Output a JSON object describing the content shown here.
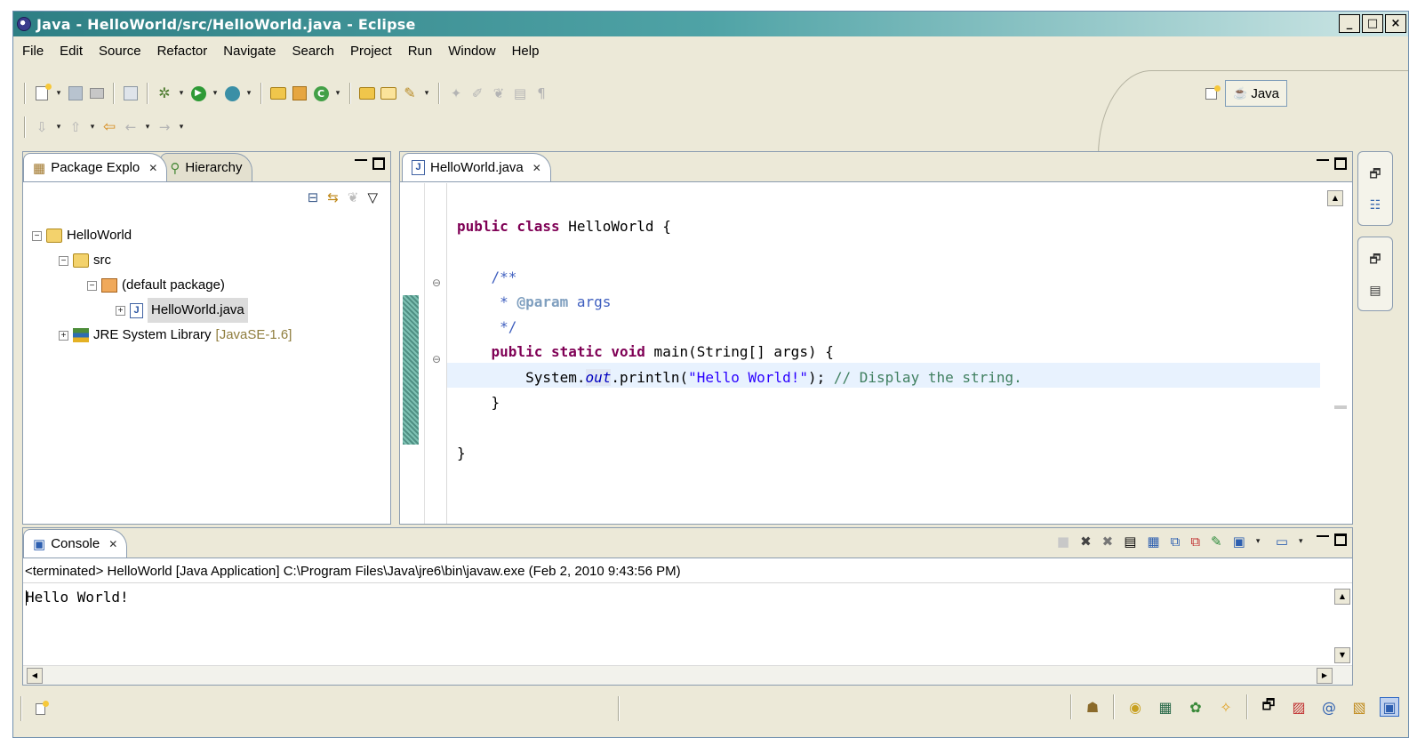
{
  "window": {
    "title": "Java - HelloWorld/src/HelloWorld.java - Eclipse",
    "controls": [
      "_",
      "□",
      "×"
    ]
  },
  "menu": [
    "File",
    "Edit",
    "Source",
    "Refactor",
    "Navigate",
    "Search",
    "Project",
    "Run",
    "Window",
    "Help"
  ],
  "perspective": {
    "label": "Java",
    "open_icon": "open-perspective-icon"
  },
  "package_explorer": {
    "tab_label": "Package Explo",
    "hierarchy_tab_label": "Hierarchy",
    "tree": {
      "project": "HelloWorld",
      "src": "src",
      "package": "(default package)",
      "file": "HelloWorld.java",
      "library": "JRE System Library",
      "library_version": "[JavaSE-1.6]"
    }
  },
  "editor": {
    "tab_label": "HelloWorld.java",
    "code": {
      "class_kw": "public class",
      "class_name": " HelloWorld {",
      "javadoc_open": "/**",
      "javadoc_star": " * ",
      "javadoc_tag": "@param",
      "javadoc_arg": " args",
      "javadoc_close": " */",
      "method_kw": "public static void",
      "method_rest": " main(String[] args) {",
      "stmt_prefix": "System.",
      "stmt_field": "out",
      "stmt_call": ".println(",
      "stmt_string": "\"Hello World!\"",
      "stmt_end": ");",
      "stmt_comment": " // Display the string.",
      "method_close": "}",
      "class_close": "}"
    }
  },
  "console": {
    "tab_label": "Console",
    "header": "<terminated> HelloWorld [Java Application] C:\\Program Files\\Java\\jre6\\bin\\javaw.exe (Feb 2, 2010 9:43:56 PM)",
    "output": "Hello World!"
  },
  "colors": {
    "keyword": "#7f0055",
    "comment": "#3f7f5f",
    "javadoc": "#3f5fbf",
    "string": "#2a00ff",
    "field": "#0000c0",
    "title_gradient_start": "#2e7f84"
  }
}
